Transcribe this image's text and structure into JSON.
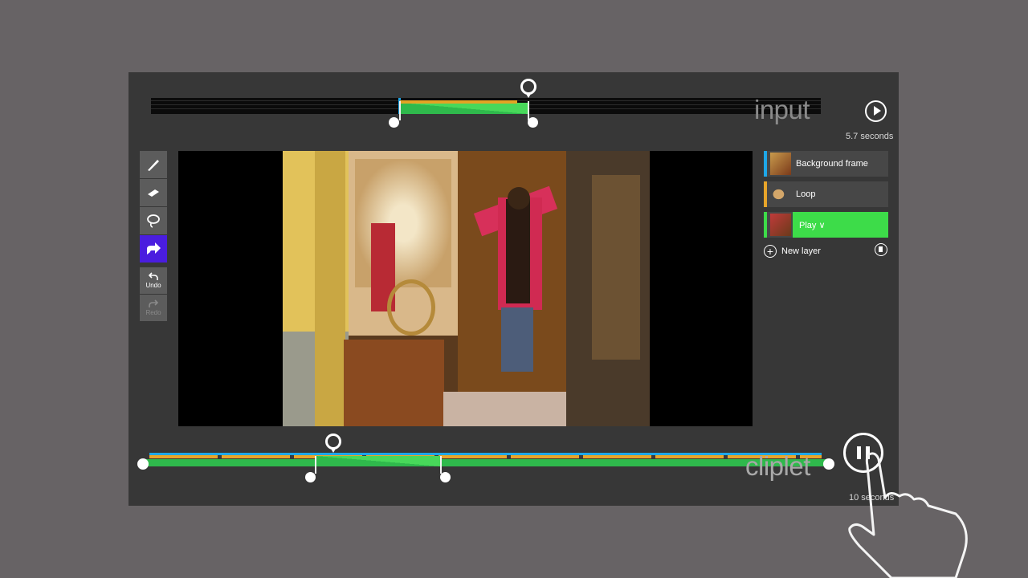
{
  "input": {
    "label": "input",
    "duration": "5.7 seconds"
  },
  "tools": {
    "undo_label": "Undo",
    "redo_label": "Redo"
  },
  "layers": {
    "items": [
      {
        "label": "Background frame",
        "tag_color": "#1ea7e8"
      },
      {
        "label": "Loop",
        "tag_color": "#e8a52a"
      },
      {
        "label": "Play ∨",
        "tag_color": "#3ddc49"
      }
    ],
    "new_layer_label": "New layer"
  },
  "cliplet": {
    "label": "cliplet",
    "duration": "10 seconds"
  },
  "colors": {
    "accent_green": "#3ddc49",
    "accent_blue": "#1ea7e8",
    "accent_orange": "#e8a52a",
    "selected_tool": "#4a1ddf"
  }
}
